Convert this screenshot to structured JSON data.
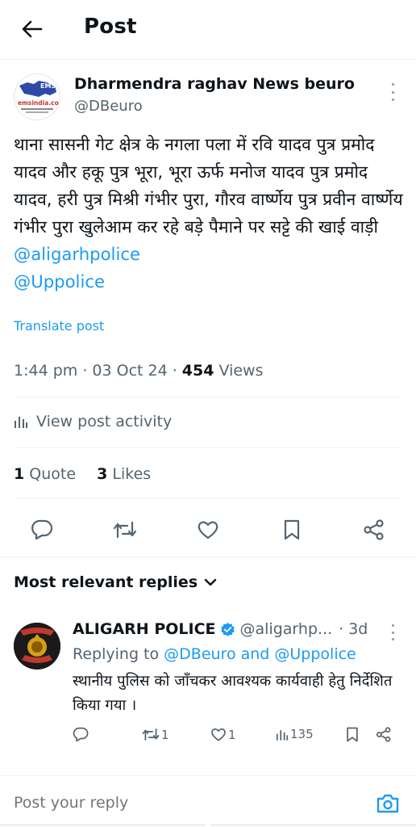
{
  "header": {
    "title": "Post"
  },
  "post": {
    "author_name": "Dharmendra raghav News beuro",
    "author_handle": "@DBeuro",
    "text": "थाना सासनी गेट क्षेत्र के नगला पला में रवि यादव पुत्र प्रमोद यादव और हकू पुत्र भूरा, भूरा ऊर्फ मनोज यादव पुत्र प्रमोद यादव, हरी पुत्र मिश्री गंभीर पुरा, गौरव वार्ष्णेय पुत्र प्रवीन वार्ष्णेय गंभीर पुरा खुलेआम कर रहे बड़े पैमाने पर सट्टे की खाई वाड़ी",
    "mention_1": "@aligarhpolice",
    "mention_2": "@Uppolice",
    "translate_label": "Translate post",
    "time": "1:44 pm · 03 Oct 24 · ",
    "views_count": "454",
    "views_label": " Views",
    "activity_label": "View post activity",
    "quotes_count": "1",
    "quotes_label": " Quote",
    "likes_count": "3",
    "likes_label": " Likes",
    "avatar_text": "EMS",
    "avatar_sub": "emsindia.com"
  },
  "replies_filter": {
    "label": "Most relevant replies"
  },
  "reply": {
    "name": "ALIGARH POLICE",
    "handle": "@aligarhp...",
    "time": "· 3d",
    "replying_prefix": "Replying to ",
    "replying_to": "@DBeuro and @Uppolice",
    "text": "स्थानीय पुलिस को जाँचकर आवश्यक कार्यवाही हेतु निर्देशित किया गया ।",
    "retweets": "1",
    "likes": "1",
    "views": "135"
  },
  "composer": {
    "placeholder": "Post your reply"
  },
  "colors": {
    "accent": "#1d9bf0",
    "text": "#0f1419",
    "muted": "#536471"
  }
}
